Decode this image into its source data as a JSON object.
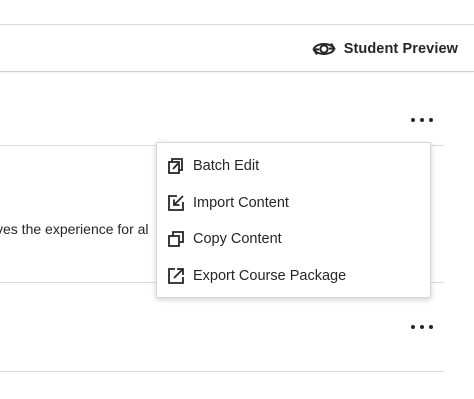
{
  "header": {
    "student_preview_label": "Student Preview",
    "student_preview_icon": "eye-refresh-icon"
  },
  "content": {
    "row_text": "ves the experience for al"
  },
  "menu": {
    "items": [
      {
        "label": "Batch Edit",
        "icon": "batch-edit-icon"
      },
      {
        "label": "Import Content",
        "icon": "import-icon"
      },
      {
        "label": "Copy Content",
        "icon": "copy-icon"
      },
      {
        "label": "Export Course Package",
        "icon": "export-icon"
      }
    ]
  },
  "colors": {
    "text": "#262626",
    "divider": "#d9d9d9",
    "menu_border": "#d6d6d6"
  }
}
